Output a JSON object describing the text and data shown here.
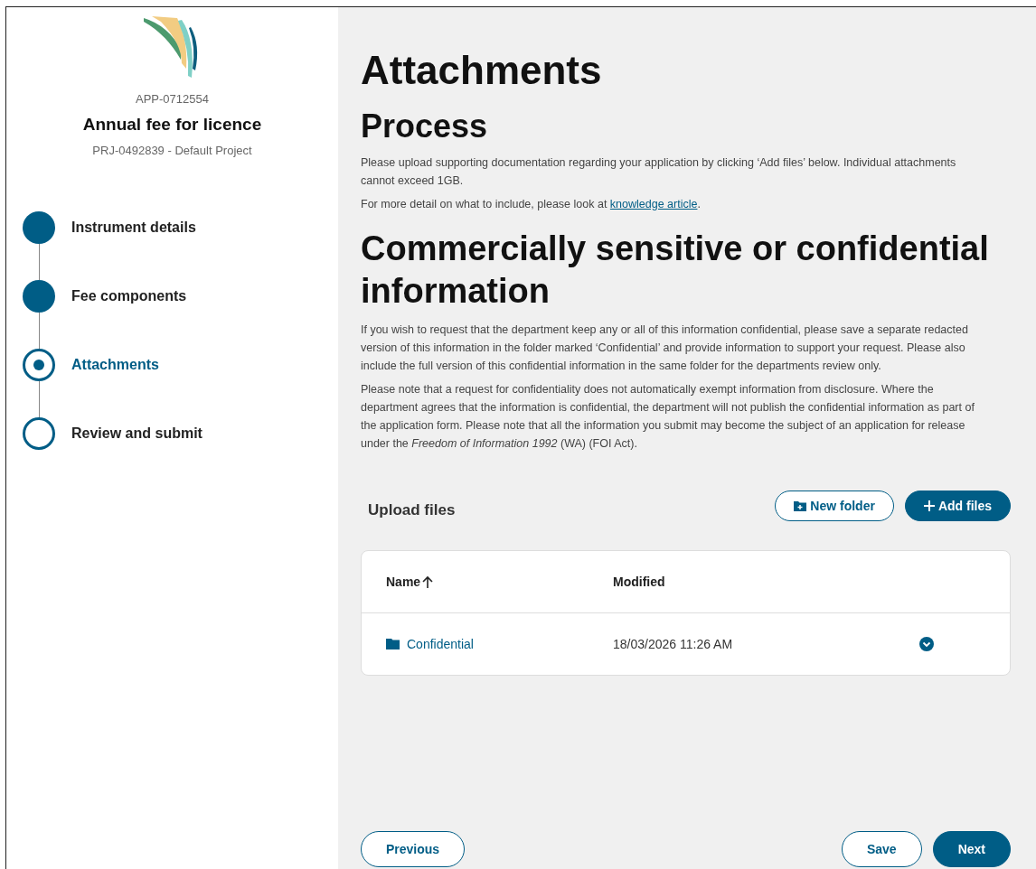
{
  "sidebar": {
    "application_id": "APP-0712554",
    "title": "Annual fee for licence",
    "project": "PRJ-0492839 - Default Project",
    "steps": [
      {
        "label": "Instrument details",
        "kind": "done",
        "selected": false
      },
      {
        "label": "Fee components",
        "kind": "done",
        "selected": false
      },
      {
        "label": "Attachments",
        "kind": "current",
        "selected": true
      },
      {
        "label": "Review and submit",
        "kind": "todo",
        "selected": false
      }
    ]
  },
  "main": {
    "title": "Attachments",
    "sections": [
      {
        "heading": "Process",
        "paragraphs": [
          {
            "text": "Please upload supporting documentation regarding your application by clicking ‘Add files’ below. Individual attachments cannot exceed 1GB."
          },
          {
            "text": "For more detail on what to include, please look at ",
            "link": "knowledge article",
            "after": "."
          }
        ]
      },
      {
        "heading": "Commercially sensitive or confidential information",
        "paragraphs": [
          {
            "text": "If you wish to request that the department keep any or all of this information confidential, please save a separate redacted version of this information in the folder marked ‘Confidential’ and provide information to support your request. Please also include the full version of this confidential information in the same folder for the departments review only."
          },
          {
            "text": "Please note that a request for confidentiality does not automatically exempt information from disclosure. Where the department agrees that the information is confidential, the department will not publish the confidential information as part of the application form. Please note that all the information you submit may become the subject of an application for release under the *Freedom of Information 1992* (WA) (FOI Act)."
          }
        ]
      }
    ],
    "upload": {
      "title": "Upload files",
      "buttons": [
        {
          "label": "New folder",
          "kind": "secondary"
        },
        {
          "label": "Add files",
          "kind": "primary"
        }
      ],
      "table": {
        "columns": [
          {
            "label": "Name",
            "sorted": true
          },
          {
            "label": "Modified",
            "sorted": false
          }
        ],
        "rows": [
          {
            "name": "Confidential",
            "kind": "folder",
            "modified": "18/03/2026 11:26 AM"
          }
        ]
      }
    },
    "footer": {
      "previous": "Previous",
      "save": "Save",
      "next": "Next"
    }
  }
}
